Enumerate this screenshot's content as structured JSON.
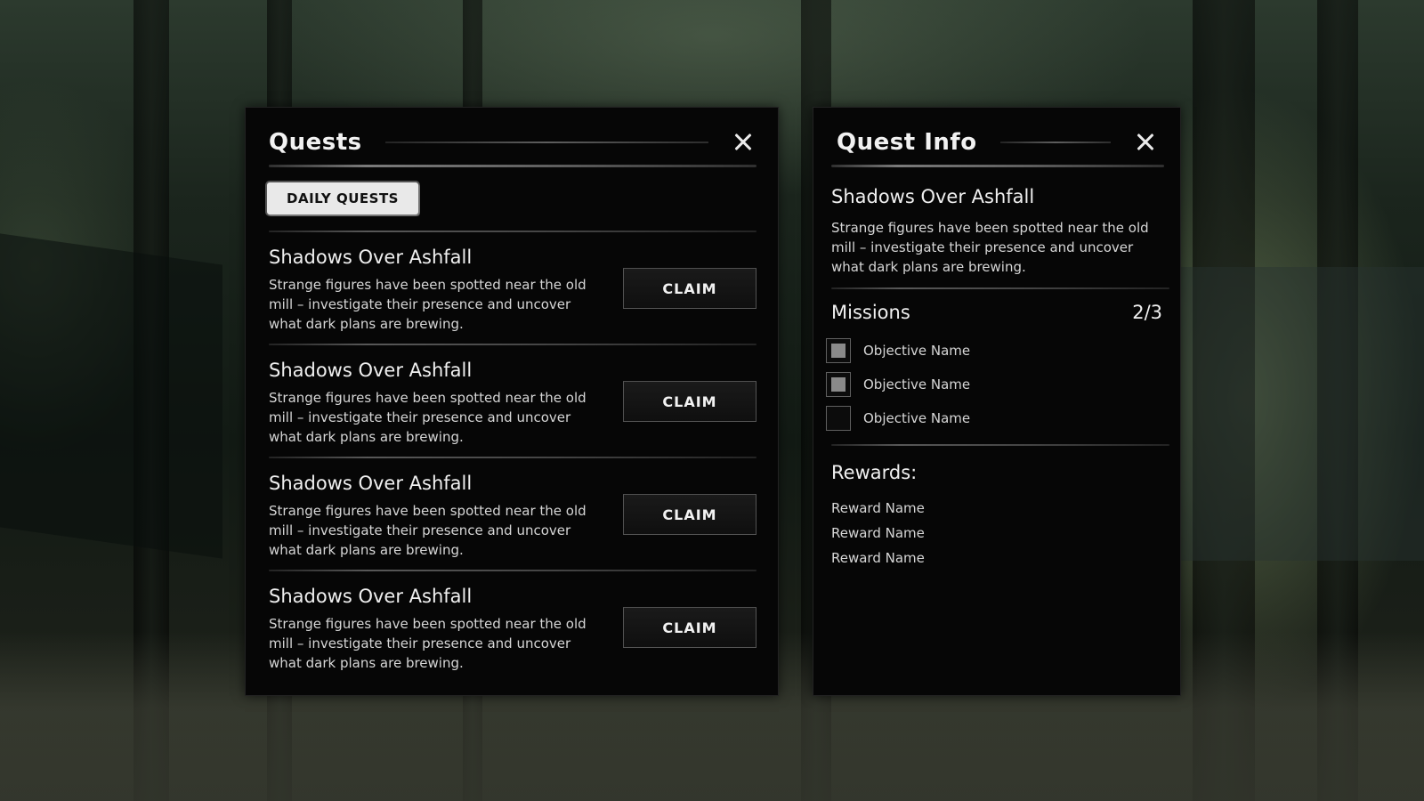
{
  "quests_panel": {
    "title": "Quests",
    "tab_label": "DAILY QUESTS",
    "claim_label": "CLAIM",
    "quests": [
      {
        "name": "Shadows Over Ashfall",
        "description": "Strange figures have been spotted near the old mill – investigate their presence and uncover what dark plans are brewing."
      },
      {
        "name": "Shadows Over Ashfall",
        "description": "Strange figures have been spotted near the old mill – investigate their presence and uncover what dark plans are brewing."
      },
      {
        "name": "Shadows Over Ashfall",
        "description": "Strange figures have been spotted near the old mill – investigate their presence and uncover what dark plans are brewing."
      },
      {
        "name": "Shadows Over Ashfall",
        "description": "Strange figures have been spotted near the old mill – investigate their presence and uncover what dark plans are brewing."
      }
    ]
  },
  "info_panel": {
    "title": "Quest Info",
    "quest_name": "Shadows Over Ashfall",
    "quest_description": "Strange figures have been spotted near the old mill – investigate their presence and uncover what dark plans are brewing.",
    "missions_title": "Missions",
    "missions_count": "2/3",
    "objectives": [
      {
        "label": "Objective Name",
        "completed": true
      },
      {
        "label": "Objective Name",
        "completed": true
      },
      {
        "label": "Objective Name",
        "completed": false
      }
    ],
    "rewards_title": "Rewards:",
    "rewards": [
      "Reward Name",
      "Reward Name",
      "Reward Name"
    ]
  },
  "icons": {
    "close": "close-icon"
  },
  "colors": {
    "panel_bg": "#060606",
    "tab_bg": "#e9e9e9",
    "text_primary": "#f0f0f0",
    "text_secondary": "#d6d6d6",
    "checkbox_fill": "#8a8a8a"
  }
}
